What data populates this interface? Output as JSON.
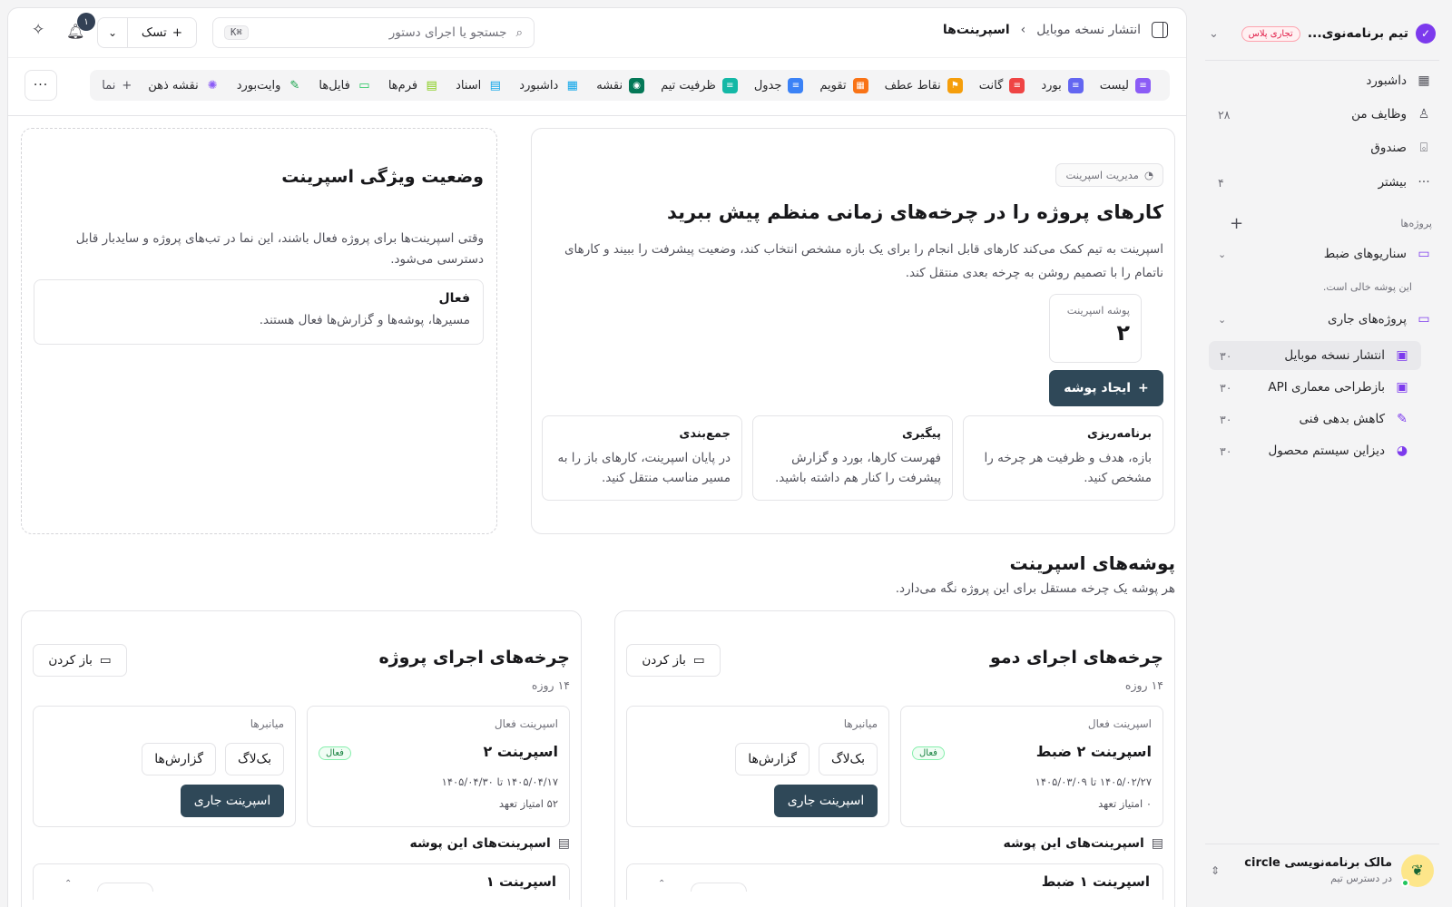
{
  "sidebar": {
    "team_name": "تیم برنامه‌نوی...",
    "plan_badge": "تجاری پلاس",
    "nav": [
      {
        "label": "داشبورد",
        "icon": "grid-icon",
        "count": ""
      },
      {
        "label": "وظایف من",
        "icon": "user-icon",
        "count": "۲۸"
      },
      {
        "label": "صندوق",
        "icon": "inbox-icon",
        "count": ""
      },
      {
        "label": "بیشتر",
        "icon": "more-icon",
        "count": "۴"
      }
    ],
    "projects_label": "پروژه‌ها",
    "folders": [
      {
        "label": "سناریوهای ضبط",
        "empty_note": "این پوشه خالی است."
      },
      {
        "label": "پروژه‌های جاری"
      }
    ],
    "projects": [
      {
        "label": "انتشار نسخه موبایل",
        "count": "۳۰",
        "icon": "briefcase-icon",
        "color": "#7c3aed",
        "active": true
      },
      {
        "label": "بازطراحی معماری API",
        "count": "۳۰",
        "icon": "briefcase-icon",
        "color": "#7c3aed",
        "active": false
      },
      {
        "label": "کاهش بدهی فنی",
        "count": "۳۰",
        "icon": "wrench-icon",
        "color": "#7c3aed",
        "active": false
      },
      {
        "label": "دیزاین سیستم محصول",
        "count": "۳۰",
        "icon": "palette-icon",
        "color": "#7c3aed",
        "active": false
      }
    ],
    "user": {
      "name": "مالک برنامه‌نویسی circle",
      "subtitle": "در دسترس تیم"
    }
  },
  "topbar": {
    "breadcrumb_parent": "انتشار نسخه موبایل",
    "breadcrumb_current": "اسپرینت‌ها",
    "search_placeholder": "جستجو یا اجرای دستور",
    "search_shortcut": "⌘K",
    "task_button": "تسک",
    "notification_count": "۱"
  },
  "views": [
    {
      "label": "لیست",
      "color": "#8b5cf6",
      "icon": "list-icon"
    },
    {
      "label": "بورد",
      "color": "#6366f1",
      "icon": "board-icon"
    },
    {
      "label": "گانت",
      "color": "#ef4444",
      "icon": "gantt-icon"
    },
    {
      "label": "نقاط عطف",
      "color": "#f59e0b",
      "icon": "flag-icon"
    },
    {
      "label": "تقویم",
      "color": "#f97316",
      "icon": "calendar-icon"
    },
    {
      "label": "جدول",
      "color": "#3b82f6",
      "icon": "table-icon"
    },
    {
      "label": "ظرفیت تیم",
      "color": "#14b8a6",
      "icon": "capacity-icon"
    },
    {
      "label": "نقشه",
      "color": "#047857",
      "icon": "map-pin-icon"
    },
    {
      "label": "داشبورد",
      "color": "#0ea5e9",
      "icon": "dashboard-icon"
    },
    {
      "label": "اسناد",
      "color": "#0ea5e9",
      "icon": "doc-icon"
    },
    {
      "label": "فرم‌ها",
      "color": "#84cc16",
      "icon": "form-icon"
    },
    {
      "label": "فایل‌ها",
      "color": "#22c55e",
      "icon": "folder-icon"
    },
    {
      "label": "وایت‌بورد",
      "color": "#16a34a",
      "icon": "whiteboard-icon"
    },
    {
      "label": "نقشه ذهن",
      "color": "#8b5cf6",
      "icon": "brain-icon"
    }
  ],
  "add_view_label": "نما",
  "hero": {
    "chip": "مدیریت اسپرینت",
    "title": "کارهای پروژه را در چرخه‌های زمانی منظم پیش ببرید",
    "description": "اسپرینت به تیم کمک می‌کند کارهای قابل انجام را برای یک بازه مشخص انتخاب کند، وضعیت پیشرفت را ببیند و کارهای ناتمام را با تصمیم روشن به چرخه بعدی منتقل کند.",
    "stat_label": "پوشه اسپرینت",
    "stat_value": "۲",
    "create_button": "ایجاد پوشه",
    "steps": [
      {
        "title": "برنامه‌ریزی",
        "desc": "بازه، هدف و ظرفیت هر چرخه را مشخص کنید."
      },
      {
        "title": "پیگیری",
        "desc": "فهرست کارها، بورد و گزارش پیشرفت را کنار هم داشته باشید."
      },
      {
        "title": "جمع‌بندی",
        "desc": "در پایان اسپرینت، کارهای باز را به مسیر مناسب منتقل کنید."
      }
    ]
  },
  "feature_status": {
    "title": "وضعیت ویژگی اسپرینت",
    "description": "وقتی اسپرینت‌ها برای پروژه فعال باشند، این نما در تب‌های پروژه و سایدبار قابل دسترسی می‌شود.",
    "state_title": "فعال",
    "state_desc": "مسیرها، پوشه‌ها و گزارش‌ها فعال هستند."
  },
  "folders_section": {
    "title": "پوشه‌های اسپرینت",
    "description": "هر پوشه یک چرخه مستقل برای این پروژه نگه می‌دارد.",
    "open_label": "باز کردن",
    "active_label": "اسپرینت فعال",
    "shortcuts_label": "میانبرها",
    "backlog_label": "بک‌لاگ",
    "reports_label": "گزارش‌ها",
    "current_label": "اسپرینت جاری",
    "list_label": "اسپرینت‌های این پوشه",
    "items": [
      {
        "title": "چرخه‌های اجرای دمو",
        "duration": "۱۴ روزه",
        "sprint_name": "اسپرینت ۲ ضبط",
        "badge": "فعال",
        "dates": "۱۴۰۵/۰۲/۲۷ تا ۱۴۰۵/۰۳/۰۹",
        "points": "۰ امتیاز تعهد",
        "peek_name": "اسپرینت ۱ ضبط"
      },
      {
        "title": "چرخه‌های اجرای پروژه",
        "duration": "۱۴ روزه",
        "sprint_name": "اسپرینت ۲",
        "badge": "فعال",
        "dates": "۱۴۰۵/۰۴/۱۷ تا ۱۴۰۵/۰۴/۳۰",
        "points": "۵۲ امتیاز تعهد",
        "peek_name": "اسپرینت ۱"
      }
    ]
  }
}
